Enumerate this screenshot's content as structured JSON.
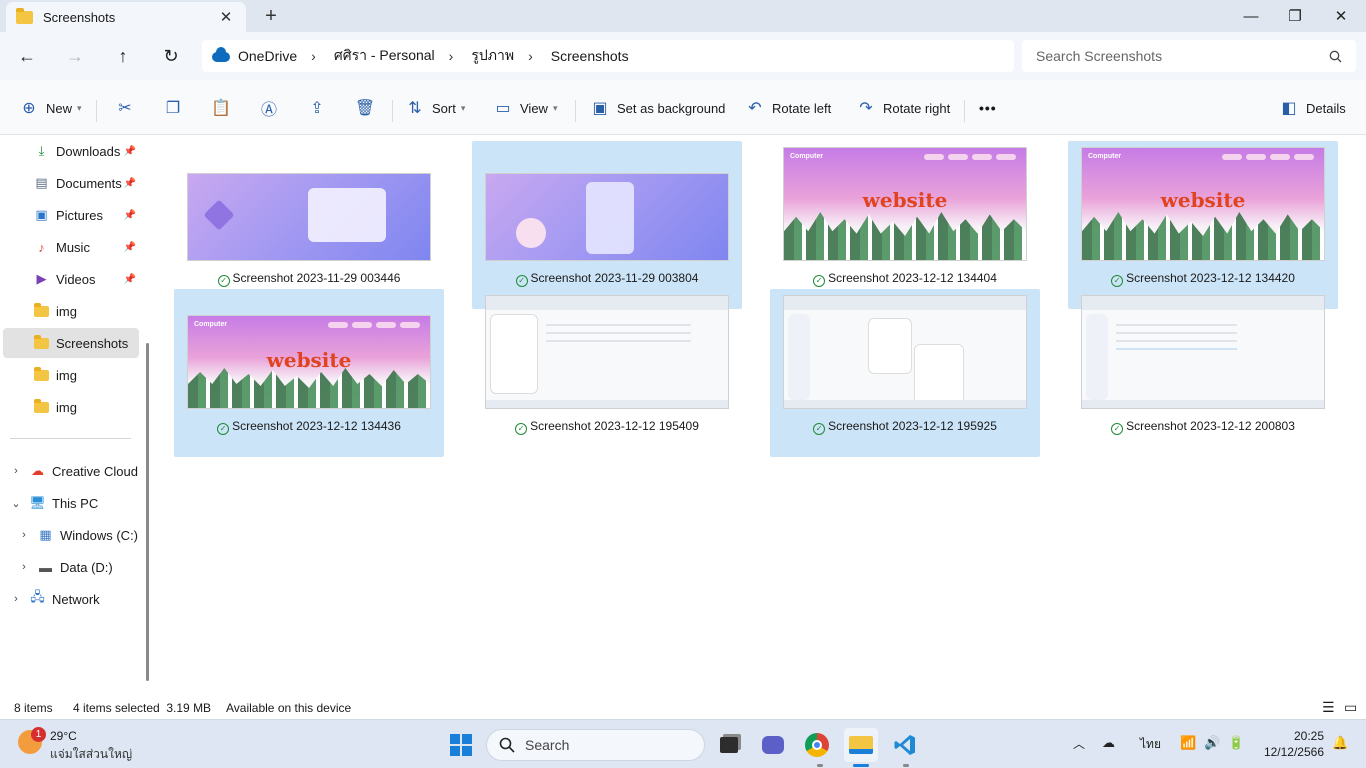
{
  "window": {
    "tab_title": "Screenshots",
    "tab_close": "✕",
    "new_tab": "+",
    "minimize": "—",
    "maximize": "❐",
    "close": "✕"
  },
  "nav": {
    "back": "←",
    "forward": "→",
    "up": "↑",
    "refresh": "↻"
  },
  "address": {
    "crumbs": [
      "OneDrive",
      "ศศิรา - Personal",
      "รูปภาพ",
      "Screenshots"
    ],
    "separator": "›"
  },
  "search": {
    "placeholder": "Search Screenshots"
  },
  "toolbar": {
    "new_label": "New",
    "sort_label": "Sort",
    "view_label": "View",
    "set_background_label": "Set as background",
    "rotate_left_label": "Rotate left",
    "rotate_right_label": "Rotate right",
    "more_label": "•••",
    "details_label": "Details"
  },
  "sidebar": {
    "quick_access": [
      {
        "label": "Downloads",
        "icon": "download-icon",
        "pinned": true
      },
      {
        "label": "Documents",
        "icon": "documents-icon",
        "pinned": true
      },
      {
        "label": "Pictures",
        "icon": "pictures-icon",
        "pinned": true
      },
      {
        "label": "Music",
        "icon": "music-icon",
        "pinned": true
      },
      {
        "label": "Videos",
        "icon": "videos-icon",
        "pinned": true
      },
      {
        "label": "img",
        "icon": "folder-icon"
      },
      {
        "label": "Screenshots",
        "icon": "folder-icon",
        "selected": true
      },
      {
        "label": "img",
        "icon": "folder-icon"
      },
      {
        "label": "img",
        "icon": "folder-icon"
      }
    ],
    "tree": [
      {
        "label": "Creative Cloud F",
        "expander": "›"
      },
      {
        "label": "This PC",
        "expander": "⌄"
      },
      {
        "label": "Windows (C:)",
        "expander": "›"
      },
      {
        "label": "Data (D:)",
        "expander": "›"
      },
      {
        "label": "Network",
        "expander": "›"
      }
    ]
  },
  "files": [
    {
      "name": "Screenshot 2023-11-29 003446",
      "selected": false,
      "kind": "purple"
    },
    {
      "name": "Screenshot 2023-11-29 003804",
      "selected": true,
      "kind": "purple"
    },
    {
      "name": "Screenshot 2023-12-12 134404",
      "selected": false,
      "kind": "christmas"
    },
    {
      "name": "Screenshot 2023-12-12 134420",
      "selected": true,
      "kind": "christmas"
    },
    {
      "name": "Screenshot 2023-12-12 134436",
      "selected": true,
      "kind": "christmas"
    },
    {
      "name": "Screenshot 2023-12-12 195409",
      "selected": false,
      "kind": "explorer"
    },
    {
      "name": "Screenshot 2023-12-12 195925",
      "selected": true,
      "kind": "explorer"
    },
    {
      "name": "Screenshot 2023-12-12 200803",
      "selected": false,
      "kind": "explorer"
    }
  ],
  "thumb_text": {
    "website": "website",
    "brand": "Computer"
  },
  "status": {
    "items": "8 items",
    "selected": "4 items selected  3.19 MB",
    "availability": "Available on this device"
  },
  "taskbar": {
    "weather_temp": "29°C",
    "weather_desc": "แจ่มใสส่วนใหญ่",
    "weather_badge": "1",
    "search_label": "Search",
    "language": "ไทย",
    "time": "20:25",
    "date": "12/12/2566"
  },
  "colors": {
    "selection": "#cce4f7",
    "accent": "#0f6cbd",
    "sync_ok": "#1e8a36"
  }
}
